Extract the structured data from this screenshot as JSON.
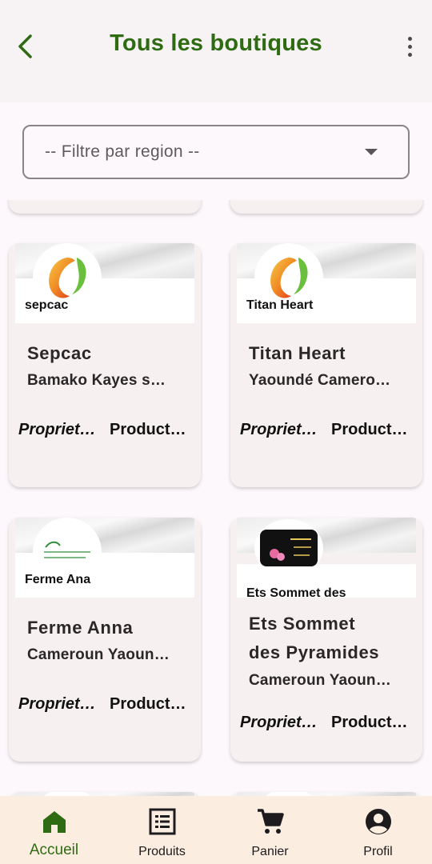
{
  "header": {
    "title": "Tous les boutiques"
  },
  "filter": {
    "placeholder": "-- Filtre par region --"
  },
  "shops": [
    {
      "banner_label": "sepcac",
      "name": "Sepcac",
      "address": "Bamako Kayes s…",
      "owner_link": "Propriet…",
      "products_link": "Product…",
      "logo": "mango-icon"
    },
    {
      "banner_label": "Titan Heart",
      "name": "Titan Heart",
      "address": "Yaoundé Camero…",
      "owner_link": "Propriet…",
      "products_link": "Product…",
      "logo": "mango-icon"
    },
    {
      "banner_label": "Ferme Ana",
      "name": "Ferme Anna",
      "address": "Cameroun Yaoun…",
      "owner_link": "Propriet…",
      "products_link": "Product…",
      "logo": "farm-logo"
    },
    {
      "banner_label": "Ets Sommet des",
      "name_line1": "Ets Sommet",
      "name_line2": "des Pyramides",
      "address": "Cameroun Yaoun…",
      "owner_link": "Propriet…",
      "products_link": "Product…",
      "logo": "pyramides-logo"
    }
  ],
  "bottom_nav": [
    {
      "label": "Accueil",
      "icon": "home-icon",
      "active": true
    },
    {
      "label": "Produits",
      "icon": "list-icon",
      "active": false
    },
    {
      "label": "Panier",
      "icon": "cart-icon",
      "active": false
    },
    {
      "label": "Profil",
      "icon": "account-icon",
      "active": false
    }
  ],
  "colors": {
    "primary": "#2e6b12",
    "nav_background": "#fbeee0",
    "card_background": "#f7f0f0"
  }
}
